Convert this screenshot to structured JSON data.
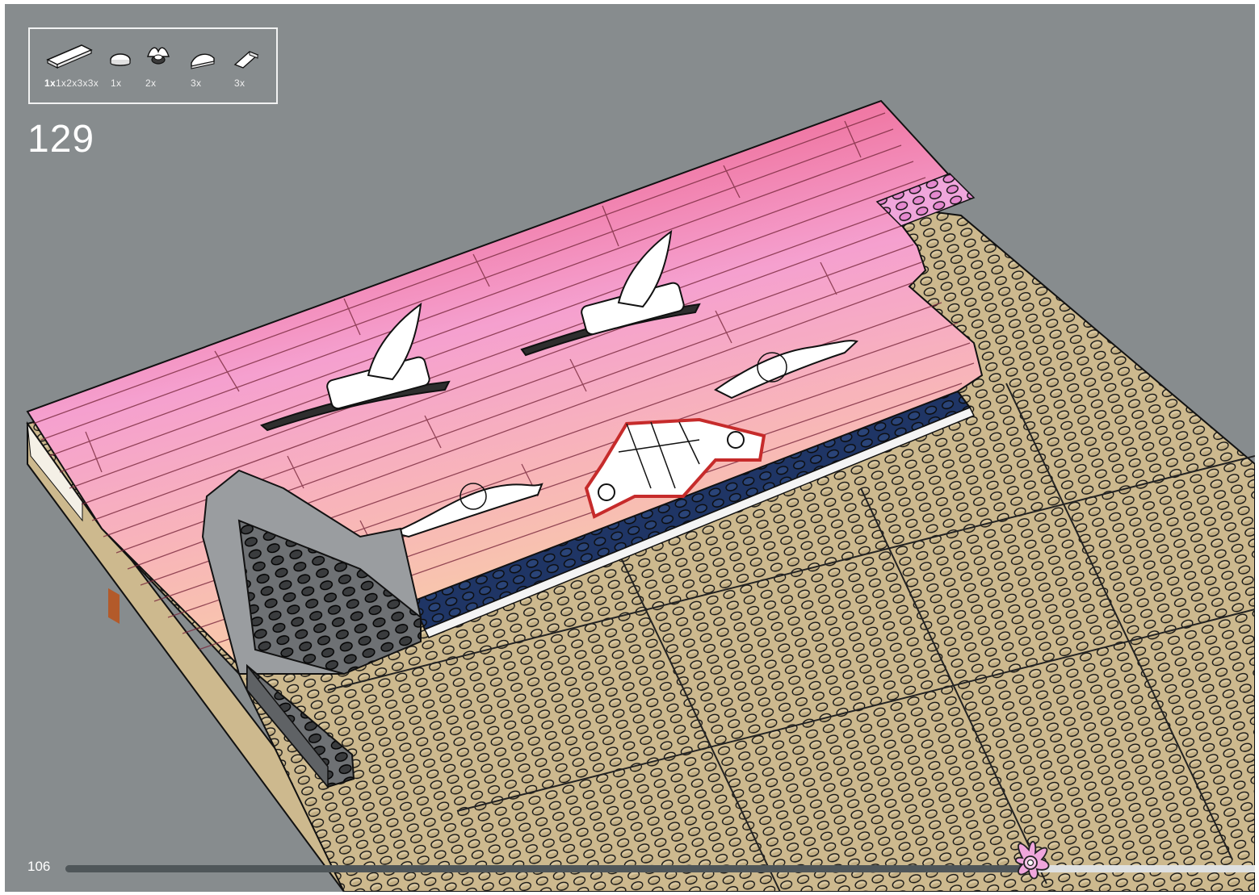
{
  "instruction": {
    "step_number": "129",
    "page_number": "106",
    "progress_fraction": 0.81
  },
  "parts": [
    {
      "icon": "white-tile-1x2x3x3x-icon",
      "qty": "1x",
      "qty_suffix": "1x2x3x3x"
    },
    {
      "icon": "white-round-tile-icon",
      "qty": "1x",
      "qty_suffix": ""
    },
    {
      "icon": "white-wing-element-icon",
      "qty": "2x",
      "qty_suffix": ""
    },
    {
      "icon": "white-curved-slope-icon",
      "qty": "3x",
      "qty_suffix": ""
    },
    {
      "icon": "white-wedge-tile-icon",
      "qty": "3x",
      "qty_suffix": ""
    }
  ],
  "colors": {
    "background": "#878c8e",
    "baseplate": "#cdb98e",
    "sky_dark_pink": "#ea5a86",
    "sky_light_pink": "#f5a0cf",
    "sky_peach": "#f8c6a8",
    "mountain_blue": "#1f3565",
    "snow_white": "#ffffff",
    "rock_grey": "#8e9194",
    "highlight_red": "#c62b2b"
  }
}
